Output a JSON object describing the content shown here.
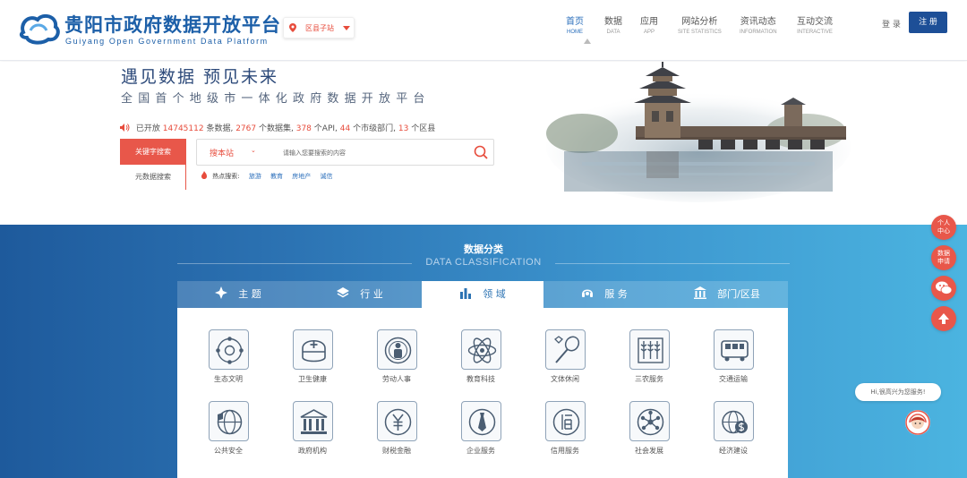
{
  "brand": {
    "title": "贵阳市政府数据开放平台",
    "subtitle": "Guiyang Open Government Data Platform",
    "colors": {
      "primary": "#1c5fa8",
      "accent": "#e8574a",
      "navy": "#1d4f97"
    }
  },
  "region_selector": {
    "label": "区县子站",
    "icon": "location-pin-icon"
  },
  "nav": [
    {
      "zh": "首页",
      "en": "HOME"
    },
    {
      "zh": "数据",
      "en": "DATA"
    },
    {
      "zh": "应用",
      "en": "APP"
    },
    {
      "zh": "网站分析",
      "en": "SITE STATISTICS"
    },
    {
      "zh": "资讯动态",
      "en": "INFORMATION"
    },
    {
      "zh": "互动交流",
      "en": "INTERACTIVE"
    }
  ],
  "auth": {
    "login": "登 录",
    "register": "注 册"
  },
  "hero": {
    "slogan": "遇见数据  预见未来",
    "tagline": "全国首个地级市一体化政府数据开放平台",
    "stats": {
      "prefix": "已开放",
      "records": "14745112",
      "records_unit": "条数据,",
      "datasets": "2767",
      "datasets_unit": "个数据集,",
      "apis": "378",
      "apis_unit": "个API,",
      "depts": "44",
      "depts_unit": "个市级部门,",
      "counties": "13",
      "counties_unit": "个区县"
    }
  },
  "search": {
    "tab_keyword": "关键字搜索",
    "tab_meta": "元数据搜索",
    "site_select": "搜本站",
    "placeholder": "请输入您要搜索的内容",
    "hot_label": "热点搜索:",
    "hot_keywords": [
      "旅游",
      "教育",
      "房地产",
      "诚信"
    ]
  },
  "classification": {
    "title": "数据分类",
    "subtitle": "DATA CLASSIFICATION",
    "tabs": [
      {
        "label": "主 题",
        "icon": "compass-icon"
      },
      {
        "label": "行 业",
        "icon": "layers-icon"
      },
      {
        "label": "领 域",
        "icon": "bar-chart-icon"
      },
      {
        "label": "服 务",
        "icon": "headset-icon"
      },
      {
        "label": "部门/区县",
        "icon": "building-icon"
      }
    ],
    "active_tab": "领 域",
    "categories": [
      {
        "label": "生态文明",
        "icon": "ecology-icon"
      },
      {
        "label": "卫生健康",
        "icon": "health-icon"
      },
      {
        "label": "劳动人事",
        "icon": "labor-icon"
      },
      {
        "label": "教育科技",
        "icon": "atom-icon"
      },
      {
        "label": "文体休闲",
        "icon": "sports-icon"
      },
      {
        "label": "三农服务",
        "icon": "wheat-icon"
      },
      {
        "label": "交通运输",
        "icon": "bus-icon"
      },
      {
        "label": "公共安全",
        "icon": "globe-shield-icon"
      },
      {
        "label": "政府机构",
        "icon": "government-icon"
      },
      {
        "label": "财税金融",
        "icon": "yuan-icon"
      },
      {
        "label": "企业服务",
        "icon": "tie-icon"
      },
      {
        "label": "信用服务",
        "icon": "credit-icon"
      },
      {
        "label": "社会发展",
        "icon": "network-icon"
      },
      {
        "label": "经济建设",
        "icon": "globe-dollar-icon"
      }
    ]
  },
  "floating": {
    "personal": "个人中心",
    "request": "数据申请",
    "assistant_greeting": "Hi,很高兴为您服务!"
  }
}
